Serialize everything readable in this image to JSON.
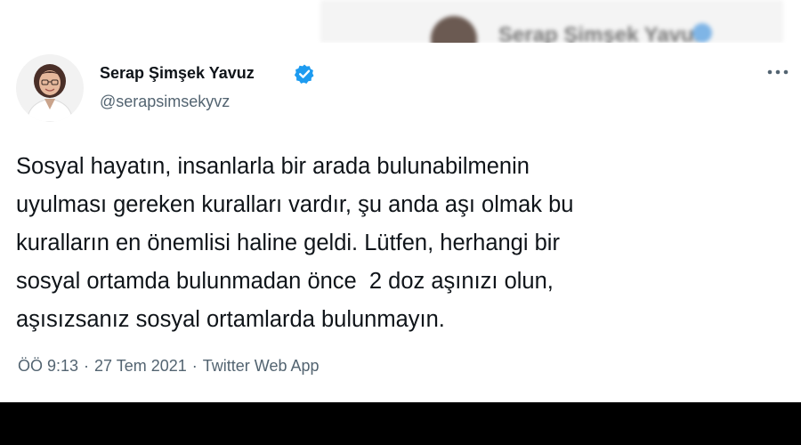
{
  "background_tweet": {
    "author_name": "Serap Şimşek Yavuz"
  },
  "tweet": {
    "author_name": "Serap Şimşek Yavuz",
    "author_handle": "@serapsimsekyvz",
    "verified": true,
    "text_lines": [
      "Sosyal hayatın, insanlarla bir arada bulunabilmenin",
      "uyulması gereken kuralları vardır, şu anda aşı olmak bu",
      "kuralların en önemlisi haline geldi. Lütfen, herhangi bir",
      "sosyal ortamda bulunmadan önce  2 doz aşınızı olun,",
      "aşısızsanız sosyal ortamlarda bulunmayın."
    ],
    "time": "ÖÖ 9:13",
    "date": "27 Tem 2021",
    "source": "Twitter Web App",
    "separator": "·"
  },
  "icons": {
    "verified": "verified-badge-icon",
    "more": "more-options-icon",
    "avatar": "profile-photo"
  },
  "colors": {
    "verified_blue": "#1d9bf0",
    "text_primary": "#0f1419",
    "text_secondary": "#536471",
    "letterbox": "#000000"
  }
}
